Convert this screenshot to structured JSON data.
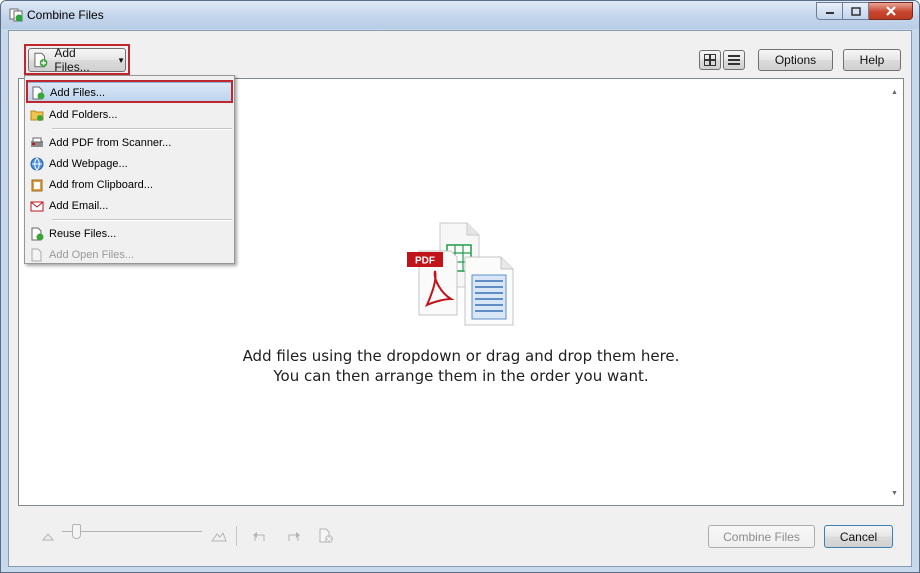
{
  "window": {
    "title": "Combine Files"
  },
  "toolbar": {
    "add_files_label": "Add Files...",
    "options_label": "Options",
    "help_label": "Help",
    "view_modes": [
      "thumbnail-view-icon",
      "list-view-icon"
    ]
  },
  "menu": {
    "items": [
      {
        "label": "Add Files...",
        "icon": "add-file-icon",
        "selected": true
      },
      {
        "label": "Add Folders...",
        "icon": "add-folder-icon"
      },
      {
        "label": "Add PDF from Scanner...",
        "icon": "scanner-icon"
      },
      {
        "label": "Add Webpage...",
        "icon": "webpage-icon"
      },
      {
        "label": "Add from Clipboard...",
        "icon": "clipboard-icon"
      },
      {
        "label": "Add Email...",
        "icon": "email-icon"
      },
      {
        "label": "Reuse Files...",
        "icon": "reuse-files-icon"
      },
      {
        "label": "Add Open Files...",
        "icon": "open-files-icon",
        "disabled": true
      }
    ]
  },
  "canvas": {
    "message_line1": "Add files using the dropdown or drag and drop them here.",
    "message_line2": "You can then arrange them in the order you want.",
    "illustration_badge": "PDF"
  },
  "footer": {
    "combine_label": "Combine Files",
    "cancel_label": "Cancel"
  },
  "colors": {
    "highlight": "#c0262b",
    "pdf_red": "#c1131a",
    "selection": "#bcd3ed"
  }
}
